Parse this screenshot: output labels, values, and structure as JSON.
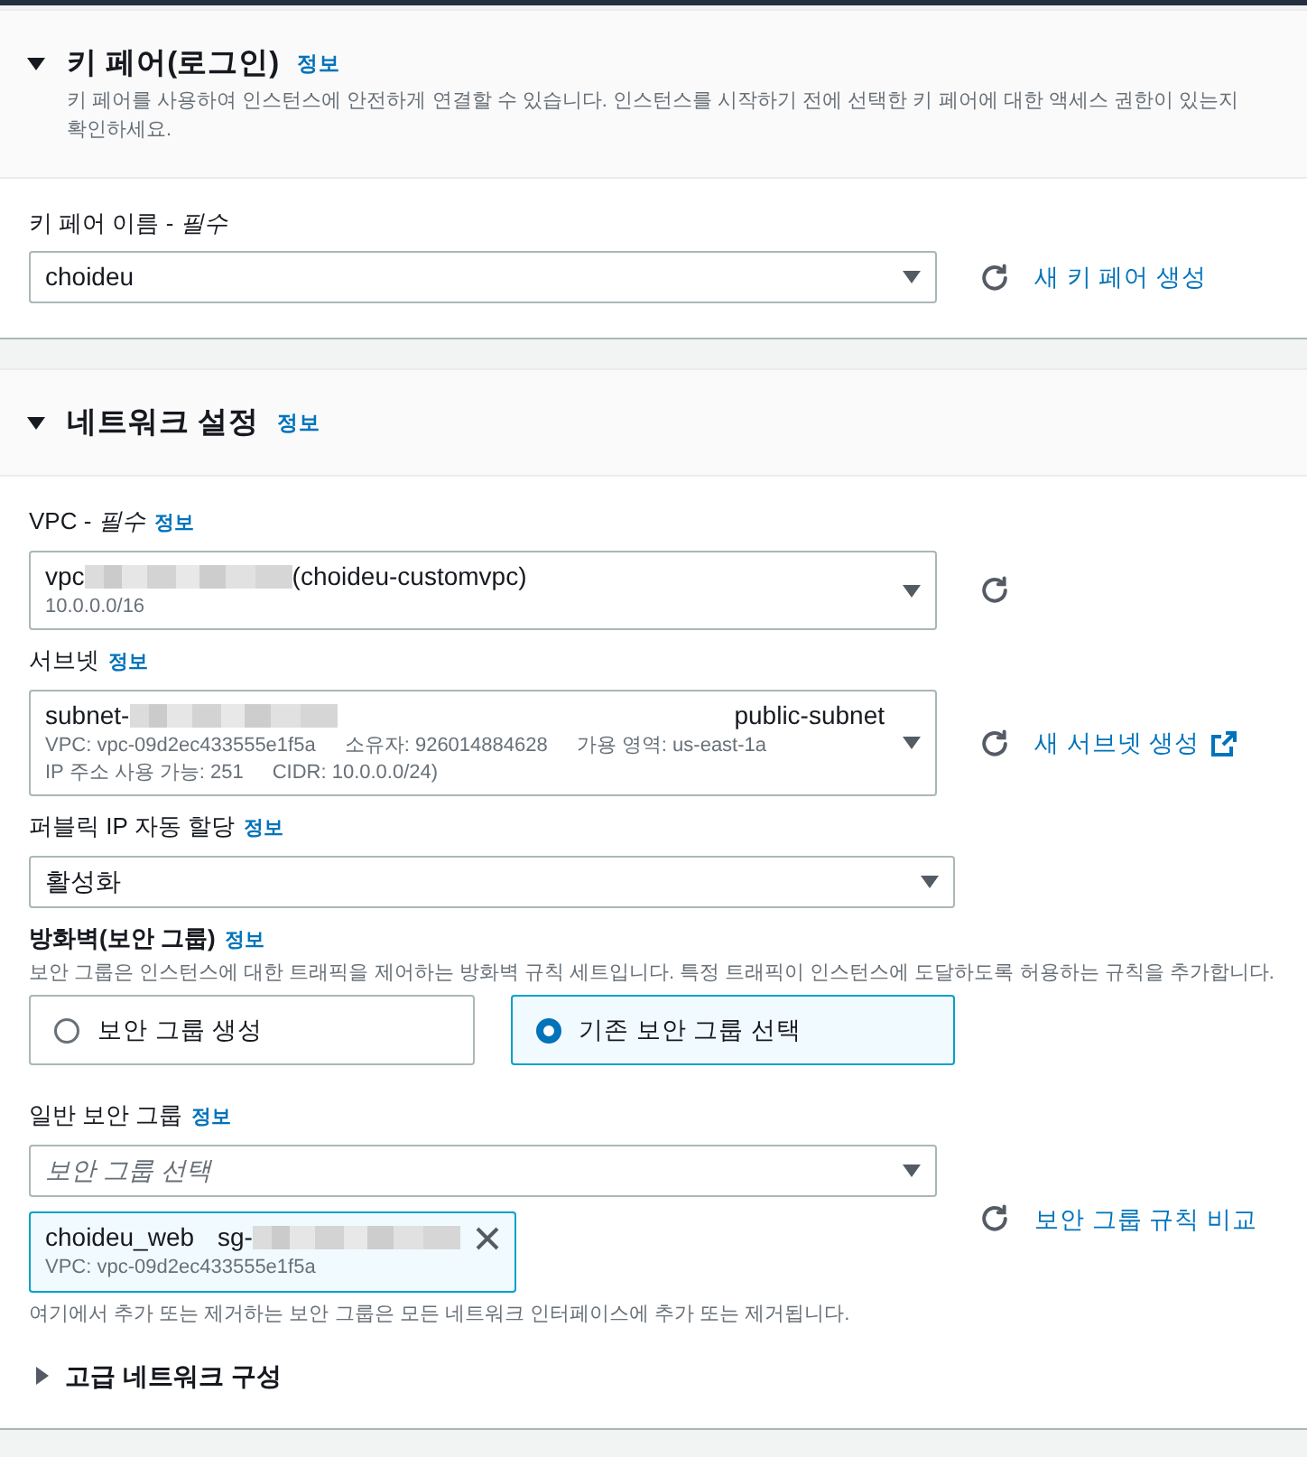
{
  "sections": [
    {
      "title": "키 페어(로그인)",
      "info": "정보",
      "expanded": true,
      "description": "키 페어를 사용하여 인스턴스에 안전하게 연결할 수 있습니다. 인스턴스를 시작하기 전에 선택한 키 페어에 대한 액세스 권한이 있는지 확인하세요.",
      "fields": [
        {
          "kind": "select",
          "label": "키 페어 이름 - *필수*",
          "value": [
            {
              "kind": "text",
              "text": "choideu"
            }
          ],
          "refresh": true,
          "action": {
            "label": "새 키 페어 생성"
          }
        }
      ]
    },
    {
      "title": "네트워크 설정",
      "info": "정보",
      "expanded": true,
      "fields": [
        {
          "kind": "select",
          "label": "VPC - *필수*",
          "info": "정보",
          "value": [
            {
              "kind": "text",
              "text": "vpc"
            },
            {
              "kind": "redacted"
            },
            {
              "kind": "text",
              "text": "(choideu-customvpc)"
            }
          ],
          "details": [
            [
              "10.0.0.0/16"
            ]
          ],
          "refresh": true
        },
        {
          "kind": "select",
          "label": "서브넷",
          "info": "정보",
          "value": [
            {
              "kind": "text",
              "text": "subnet-"
            },
            {
              "kind": "redacted"
            }
          ],
          "tag": "public-subnet",
          "details": [
            [
              "VPC: vpc-09d2ec433555e1f5a",
              "소유자: 926014884628",
              "가용 영역: us-east-1a"
            ],
            [
              "IP 주소 사용 가능: 251",
              "CIDR: 10.0.0.0/24)"
            ]
          ],
          "refresh": true,
          "action": {
            "label": "새 서브넷 생성",
            "external": true
          }
        },
        {
          "kind": "select",
          "label": "퍼블릭 IP 자동 할당",
          "info": "정보",
          "value": [
            {
              "kind": "text",
              "text": "활성화"
            }
          ]
        },
        {
          "kind": "tiles",
          "label": "방화벽(보안 그룹)",
          "info": "정보",
          "description": "보안 그룹은 인스턴스에 대한 트래픽을 제어하는 방화벽 규칙 세트입니다. 특정 트래픽이 인스턴스에 도달하도록 허용하는 규칙을 추가합니다.",
          "options": [
            {
              "label": "보안 그룹 생성",
              "selected": false
            },
            {
              "label": "기존 보안 그룹 선택",
              "selected": true
            }
          ]
        },
        {
          "kind": "multiselect",
          "label": "일반 보안 그룹",
          "info": "정보",
          "placeholder": "보안 그룹 선택",
          "tokens": [
            {
              "name": "choideu_web",
              "id": [
                {
                  "kind": "text",
                  "text": "sg-"
                },
                {
                  "kind": "redacted"
                }
              ],
              "detail": "VPC: vpc-09d2ec433555e1f5a"
            }
          ],
          "refresh": true,
          "action": {
            "label": "보안 그룹 규칙 비교"
          },
          "hint": "여기에서 추가 또는 제거하는 보안 그룹은 모든 네트워크 인터페이스에 추가 또는 제거됩니다."
        },
        {
          "kind": "expandable",
          "label": "고급 네트워크 구성",
          "expanded": false
        }
      ]
    }
  ]
}
